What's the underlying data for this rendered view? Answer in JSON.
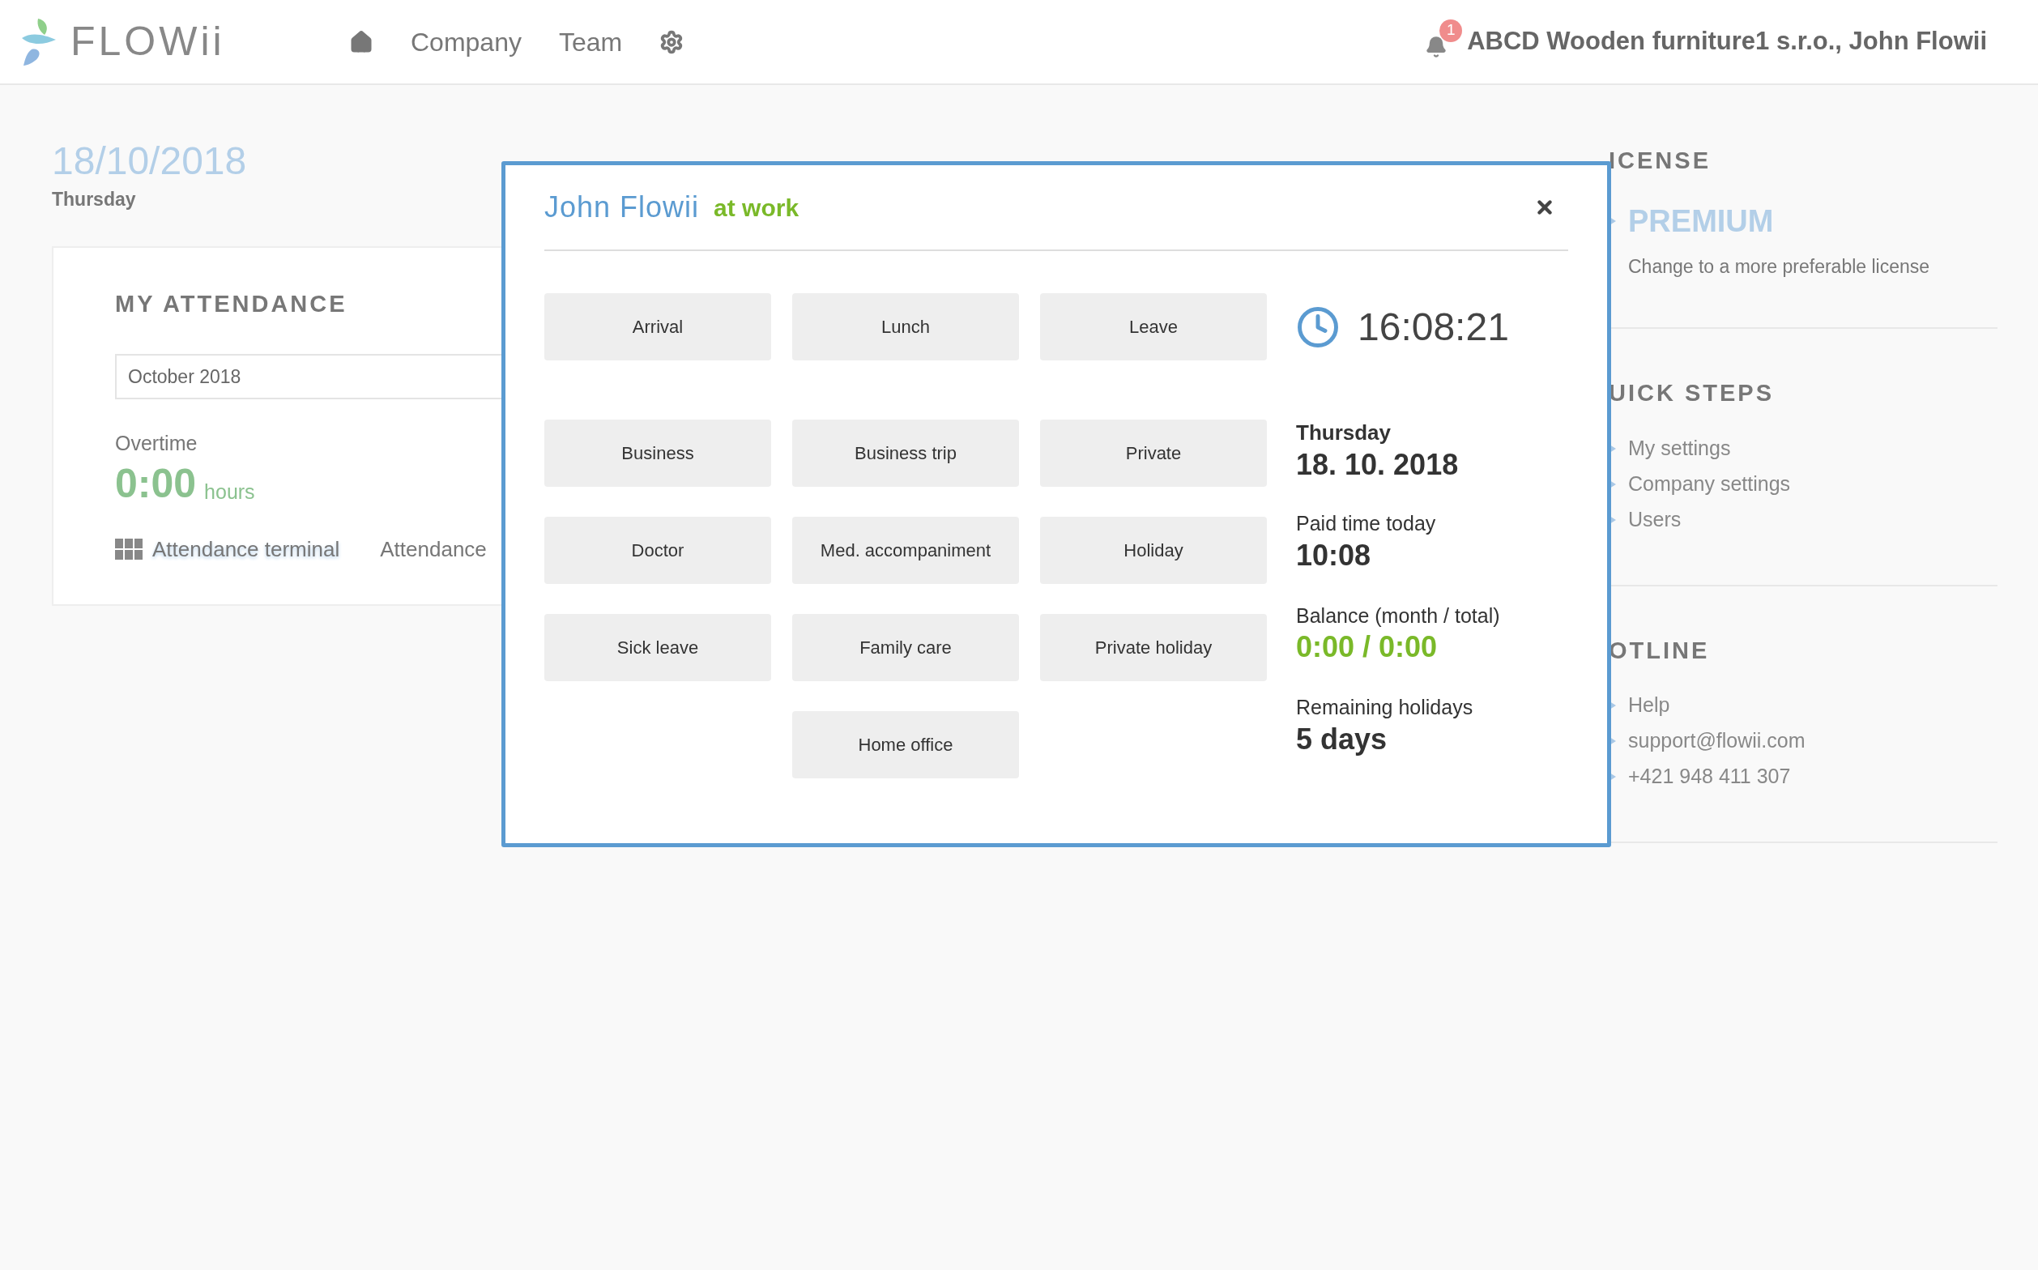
{
  "header": {
    "logo": "FLOWii",
    "nav": [
      {
        "kind": "home"
      },
      {
        "kind": "link",
        "label": "Company"
      },
      {
        "kind": "link",
        "label": "Team"
      },
      {
        "kind": "settings"
      }
    ],
    "notifications": {
      "count": "1"
    },
    "account": "ABCD Wooden furniture1 s.r.o., John Flowii"
  },
  "today": {
    "date": "18/10/2018",
    "weekday": "Thursday"
  },
  "attendance": {
    "title": "MY ATTENDANCE",
    "month": "October 2018",
    "overtime_label": "Overtime",
    "overtime_value": "0:00",
    "overtime_unit": "hours",
    "links": [
      {
        "kind": "terminal",
        "label": "Attendance terminal"
      },
      {
        "kind": "plain",
        "label": "Attendance"
      }
    ]
  },
  "modal": {
    "name": "John Flowii",
    "status": "at work",
    "button_rows": [
      [
        "Arrival",
        "Lunch",
        "Leave"
      ],
      [
        "Business",
        "Business trip",
        "Private"
      ],
      [
        "Doctor",
        "Med. accompaniment",
        "Holiday"
      ],
      [
        "Sick leave",
        "Family care",
        "Private holiday"
      ],
      [
        "Home office"
      ]
    ],
    "clock": "16:08:21",
    "weekday": "Thursday",
    "date": "18. 10. 2018",
    "stats": [
      {
        "kind": "plain",
        "label": "Paid time today",
        "value": "10:08"
      },
      {
        "kind": "balance",
        "label": "Balance (month / total)",
        "value": "0:00 / 0:00"
      },
      {
        "kind": "plain",
        "label": "Remaining holidays",
        "value": "5 days"
      }
    ]
  },
  "sidebar": [
    {
      "title": "ICENSE",
      "items": [
        {
          "kind": "plan",
          "label": "PREMIUM"
        },
        {
          "kind": "note",
          "label": "Change to a more preferable license"
        }
      ]
    },
    {
      "title": "UICK STEPS",
      "items": [
        {
          "kind": "link",
          "label": "My settings"
        },
        {
          "kind": "link",
          "label": "Company settings"
        },
        {
          "kind": "link",
          "label": "Users"
        }
      ]
    },
    {
      "title": "OTLINE",
      "items": [
        {
          "kind": "link",
          "label": "Help"
        },
        {
          "kind": "link",
          "label": "support@flowii.com"
        },
        {
          "kind": "link",
          "label": "+421 948 411 307"
        }
      ]
    }
  ]
}
